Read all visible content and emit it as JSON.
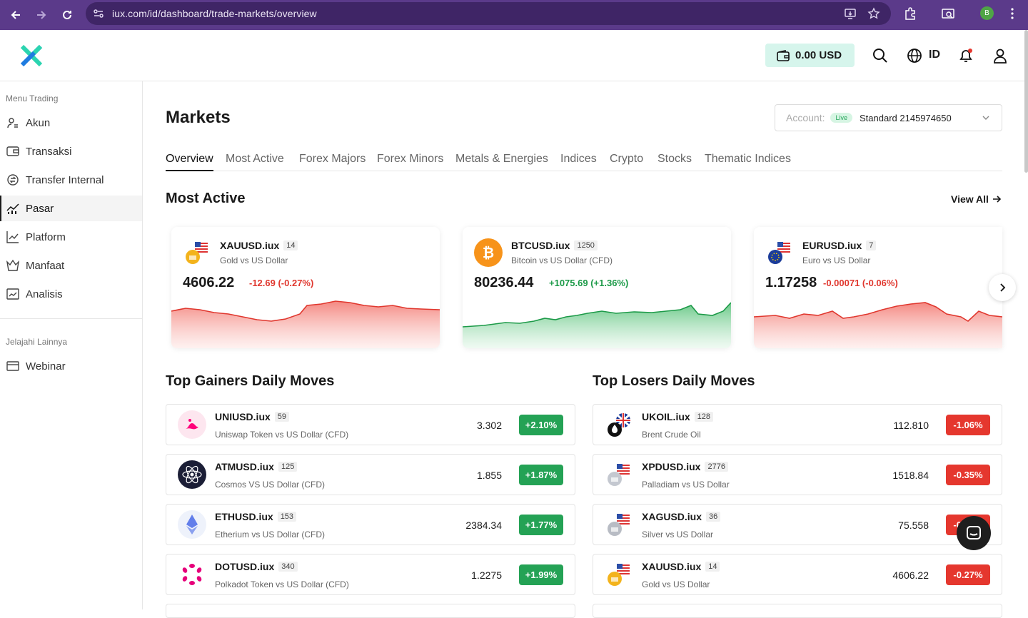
{
  "browser": {
    "url": "iux.com/id/dashboard/trade-markets/overview",
    "profile_initial": "B"
  },
  "header": {
    "balance": "0.00 USD",
    "language": "ID"
  },
  "sidebar": {
    "section1": "Menu Trading",
    "items": [
      {
        "label": "Akun",
        "icon": "account-icon"
      },
      {
        "label": "Transaksi",
        "icon": "wallet-icon"
      },
      {
        "label": "Transfer Internal",
        "icon": "transfer-icon"
      },
      {
        "label": "Pasar",
        "icon": "chart-icon",
        "active": true
      },
      {
        "label": "Platform",
        "icon": "platform-icon"
      },
      {
        "label": "Manfaat",
        "icon": "benefit-icon"
      },
      {
        "label": "Analisis",
        "icon": "analysis-icon"
      }
    ],
    "section2": "Jelajahi Lainnya",
    "extra": [
      {
        "label": "Webinar",
        "icon": "webinar-icon"
      }
    ]
  },
  "main": {
    "title": "Markets",
    "account": {
      "label": "Account:",
      "badge": "Live",
      "value": "Standard 2145974650"
    },
    "tabs": [
      "Overview",
      "Most Active",
      "Forex Majors",
      "Forex Minors",
      "Metals & Energies",
      "Indices",
      "Crypto",
      "Stocks",
      "Thematic Indices"
    ],
    "most_active_title": "Most Active",
    "view_all": "View All",
    "cards": [
      {
        "symbol": "XAUUSD.iux",
        "leverage": "14",
        "desc": "Gold vs US Dollar",
        "price": "4606.22",
        "change": "-12.69 (-0.27%)",
        "dir": "down"
      },
      {
        "symbol": "BTCUSD.iux",
        "leverage": "1250",
        "desc": "Bitcoin vs US Dollar (CFD)",
        "price": "80236.44",
        "change": "+1075.69 (+1.36%)",
        "dir": "up"
      },
      {
        "symbol": "EURUSD.iux",
        "leverage": "7",
        "desc": "Euro vs US Dollar",
        "price": "1.17258",
        "change": "-0.00071 (-0.06%)",
        "dir": "down"
      }
    ],
    "gainers_title": "Top Gainers Daily Moves",
    "losers_title": "Top Losers Daily Moves",
    "gainers": [
      {
        "symbol": "UNIUSD.iux",
        "leverage": "59",
        "desc": "Uniswap Token vs US Dollar (CFD)",
        "price": "3.302",
        "pct": "+2.10%"
      },
      {
        "symbol": "ATMUSD.iux",
        "leverage": "125",
        "desc": "Cosmos VS US Dollar (CFD)",
        "price": "1.855",
        "pct": "+1.87%"
      },
      {
        "symbol": "ETHUSD.iux",
        "leverage": "153",
        "desc": "Etherium vs US Dollar (CFD)",
        "price": "2384.34",
        "pct": "+1.77%"
      },
      {
        "symbol": "DOTUSD.iux",
        "leverage": "340",
        "desc": "Polkadot Token vs US Dollar (CFD)",
        "price": "1.2275",
        "pct": "+1.99%"
      }
    ],
    "losers": [
      {
        "symbol": "UKOIL.iux",
        "leverage": "128",
        "desc": "Brent Crude Oil",
        "price": "112.810",
        "pct": "-1.06%"
      },
      {
        "symbol": "XPDUSD.iux",
        "leverage": "2776",
        "desc": "Palladiam vs US Dollar",
        "price": "1518.84",
        "pct": "-0.35%"
      },
      {
        "symbol": "XAGUSD.iux",
        "leverage": "36",
        "desc": "Silver vs US Dollar",
        "price": "75.558",
        "pct": "-0.31%"
      },
      {
        "symbol": "XAUUSD.iux",
        "leverage": "14",
        "desc": "Gold vs US Dollar",
        "price": "4606.22",
        "pct": "-0.27%"
      }
    ]
  }
}
